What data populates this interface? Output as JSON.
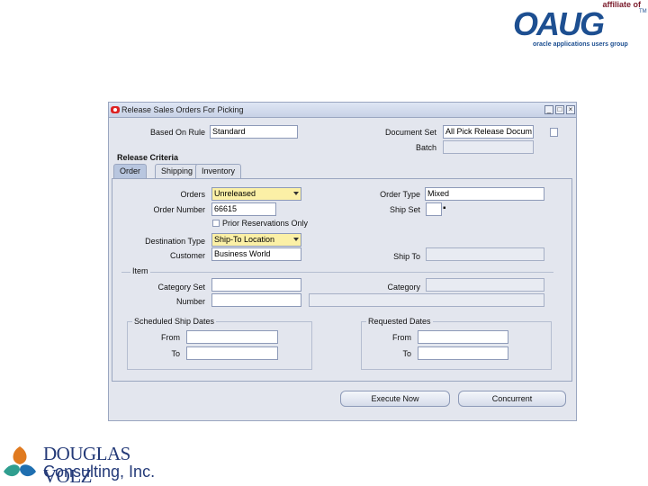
{
  "oaug_logo": {
    "affiliate_text": "affiliate of",
    "wordmark": "OAUG",
    "trademark": "TM",
    "tagline": "oracle applications users group"
  },
  "window": {
    "title": "Release Sales Orders For Picking",
    "min_glyph": "_",
    "max_glyph": "□",
    "close_glyph": "×"
  },
  "header_fields": {
    "based_on_rule_label": "Based On Rule",
    "based_on_rule_value": "Standard",
    "document_set_label": "Document Set",
    "document_set_value": "All Pick Release Docum",
    "batch_label": "Batch",
    "batch_value": ""
  },
  "release_criteria": {
    "title": "Release Criteria",
    "tabs": [
      {
        "label": "Order",
        "active": true
      },
      {
        "label": "Shipping",
        "active": false
      },
      {
        "label": "Inventory",
        "active": false
      }
    ]
  },
  "order_tab": {
    "orders_label": "Orders",
    "orders_value": "Unreleased",
    "order_number_label": "Order Number",
    "order_number_value": "66615",
    "prior_reservations_label": "Prior Reservations Only",
    "destination_type_label": "Destination Type",
    "destination_type_value": "Ship-To Location",
    "customer_label": "Customer",
    "customer_value": "Business World",
    "order_type_label": "Order Type",
    "order_type_value": "Mixed",
    "ship_set_label": "Ship Set",
    "ship_set_value": "",
    "ship_to_label": "Ship To",
    "ship_to_value": "",
    "item_group_label": "Item",
    "category_set_label": "Category Set",
    "category_set_value": "",
    "category_label": "Category",
    "category_value": "",
    "number_label": "Number",
    "number_value": "",
    "number_desc_value": "",
    "scheduled_ship_dates_label": "Scheduled Ship Dates",
    "requested_dates_label": "Requested Dates",
    "from_label": "From",
    "to_label": "To"
  },
  "buttons": {
    "execute_now": "Execute Now",
    "concurrent": "Concurrent"
  },
  "dv_logo": {
    "name": "DOUGLAS VOLZ",
    "consulting": "Consulting, Inc."
  },
  "colors": {
    "window_bg": "#e3e6ee",
    "required_field": "#fbf0a6",
    "oaug_blue": "#1d4f91",
    "dv_blue": "#243a78"
  }
}
